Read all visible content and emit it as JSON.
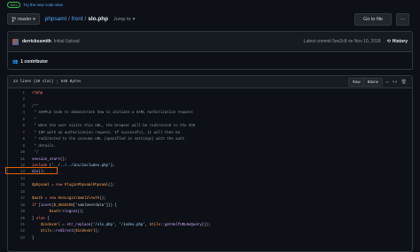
{
  "beta": {
    "badge": "Beta",
    "link": "Try the new code view"
  },
  "pathbar": {
    "branch": "master",
    "crumbs": [
      "phpsaml",
      "front",
      "slo.php"
    ],
    "separator": "/",
    "jump": "Jump to",
    "goto_label": "Go to file",
    "more_label": "···"
  },
  "commit": {
    "author": "derrickssmith",
    "message": "Initial Upload",
    "latest_prefix": "Latest commit",
    "sha": "5ee2c8",
    "date_prefix": "on",
    "date": "Nov 10, 2018",
    "history_label": "History",
    "contributors": "1 contributor"
  },
  "file": {
    "lines_info": "24 lines (20 sloc)",
    "size": "645 Bytes",
    "raw_label": "Raw",
    "blame_label": "Blame"
  },
  "code": [
    {
      "n": "1",
      "segs": [
        {
          "t": "<?php",
          "c": "t-tag"
        }
      ]
    },
    {
      "n": "2",
      "segs": []
    },
    {
      "n": "3",
      "segs": [
        {
          "t": "/**",
          "c": "t-com"
        }
      ]
    },
    {
      "n": "4",
      "segs": [
        {
          "t": " * SAMPLE Code to demonstrate how to initiate a SAML Authorization request",
          "c": "t-com"
        }
      ]
    },
    {
      "n": "5",
      "segs": [
        {
          "t": " *",
          "c": "t-com"
        }
      ]
    },
    {
      "n": "6",
      "segs": [
        {
          "t": " * When the user visits this URL, the browser will be redirected to the SSO",
          "c": "t-com"
        }
      ]
    },
    {
      "n": "7",
      "segs": [
        {
          "t": " * IdP with an authorization request. If successful, it will then be",
          "c": "t-com"
        }
      ]
    },
    {
      "n": "8",
      "segs": [
        {
          "t": " * redirected to the consume URL (specified in settings) with the auth",
          "c": "t-com"
        }
      ]
    },
    {
      "n": "9",
      "segs": [
        {
          "t": " * details.",
          "c": "t-com"
        }
      ]
    },
    {
      "n": "10",
      "segs": [
        {
          "t": " */",
          "c": "t-com"
        }
      ]
    },
    {
      "n": "11",
      "segs": [
        {
          "t": "session_start",
          "c": "t-fn"
        },
        {
          "t": "();",
          "c": ""
        }
      ]
    },
    {
      "n": "12",
      "segs": [
        {
          "t": "include",
          "c": "t-kw"
        },
        {
          "t": " (",
          "c": ""
        },
        {
          "t": "'../../../inc/includes.php'",
          "c": "t-str"
        },
        {
          "t": ");",
          "c": ""
        }
      ]
    },
    {
      "n": "13",
      "segs": [
        {
          "t": "die",
          "c": "t-fn"
        },
        {
          "t": "();",
          "c": ""
        }
      ]
    },
    {
      "n": "14",
      "segs": []
    },
    {
      "n": "15",
      "segs": [
        {
          "t": "$phpsaml",
          "c": "t-var"
        },
        {
          "t": " = ",
          "c": ""
        },
        {
          "t": "new",
          "c": "t-kw"
        },
        {
          "t": " ",
          "c": ""
        },
        {
          "t": "PluginPhpsamlPhpsaml",
          "c": "t-cls"
        },
        {
          "t": "();",
          "c": ""
        }
      ]
    },
    {
      "n": "16",
      "segs": []
    },
    {
      "n": "17",
      "segs": [
        {
          "t": "$auth",
          "c": "t-var"
        },
        {
          "t": " = ",
          "c": ""
        },
        {
          "t": "new",
          "c": "t-kw"
        },
        {
          "t": " ",
          "c": ""
        },
        {
          "t": "OneLogin\\Saml2\\Auth",
          "c": "t-cls"
        },
        {
          "t": "();",
          "c": ""
        }
      ]
    },
    {
      "n": "18",
      "segs": [
        {
          "t": "if",
          "c": "t-kw"
        },
        {
          "t": " (",
          "c": ""
        },
        {
          "t": "isset",
          "c": "t-fn"
        },
        {
          "t": "(",
          "c": ""
        },
        {
          "t": "$_SESSION",
          "c": "t-var"
        },
        {
          "t": "['samlUserdata'])) {",
          "c": ""
        }
      ]
    },
    {
      "n": "19",
      "segs": [
        {
          "t": "        ",
          "c": ""
        },
        {
          "t": "$auth",
          "c": "t-var"
        },
        {
          "t": "->",
          "c": ""
        },
        {
          "t": "logout",
          "c": "t-fn"
        },
        {
          "t": "();",
          "c": ""
        }
      ]
    },
    {
      "n": "20",
      "segs": [
        {
          "t": "} ",
          "c": ""
        },
        {
          "t": "else",
          "c": "t-kw"
        },
        {
          "t": " {",
          "c": ""
        }
      ]
    },
    {
      "n": "21",
      "segs": [
        {
          "t": "    ",
          "c": ""
        },
        {
          "t": "$indexUrl",
          "c": "t-var"
        },
        {
          "t": " = ",
          "c": ""
        },
        {
          "t": "str_replace",
          "c": "t-fn"
        },
        {
          "t": "(",
          "c": ""
        },
        {
          "t": "'/slo.php'",
          "c": "t-str"
        },
        {
          "t": ", ",
          "c": ""
        },
        {
          "t": "'/index.php'",
          "c": "t-str"
        },
        {
          "t": ", ",
          "c": ""
        },
        {
          "t": "Utils",
          "c": "t-cls"
        },
        {
          "t": "::",
          "c": ""
        },
        {
          "t": "getSelfURLNoQuery",
          "c": "t-fn"
        },
        {
          "t": "());",
          "c": ""
        }
      ]
    },
    {
      "n": "22",
      "segs": [
        {
          "t": "    ",
          "c": ""
        },
        {
          "t": "Utils",
          "c": "t-cls"
        },
        {
          "t": "::",
          "c": ""
        },
        {
          "t": "redirect",
          "c": "t-fn"
        },
        {
          "t": "(",
          "c": ""
        },
        {
          "t": "$indexUrl",
          "c": "t-var"
        },
        {
          "t": ");",
          "c": ""
        }
      ]
    },
    {
      "n": "23",
      "segs": [
        {
          "t": "}",
          "c": ""
        }
      ]
    }
  ]
}
